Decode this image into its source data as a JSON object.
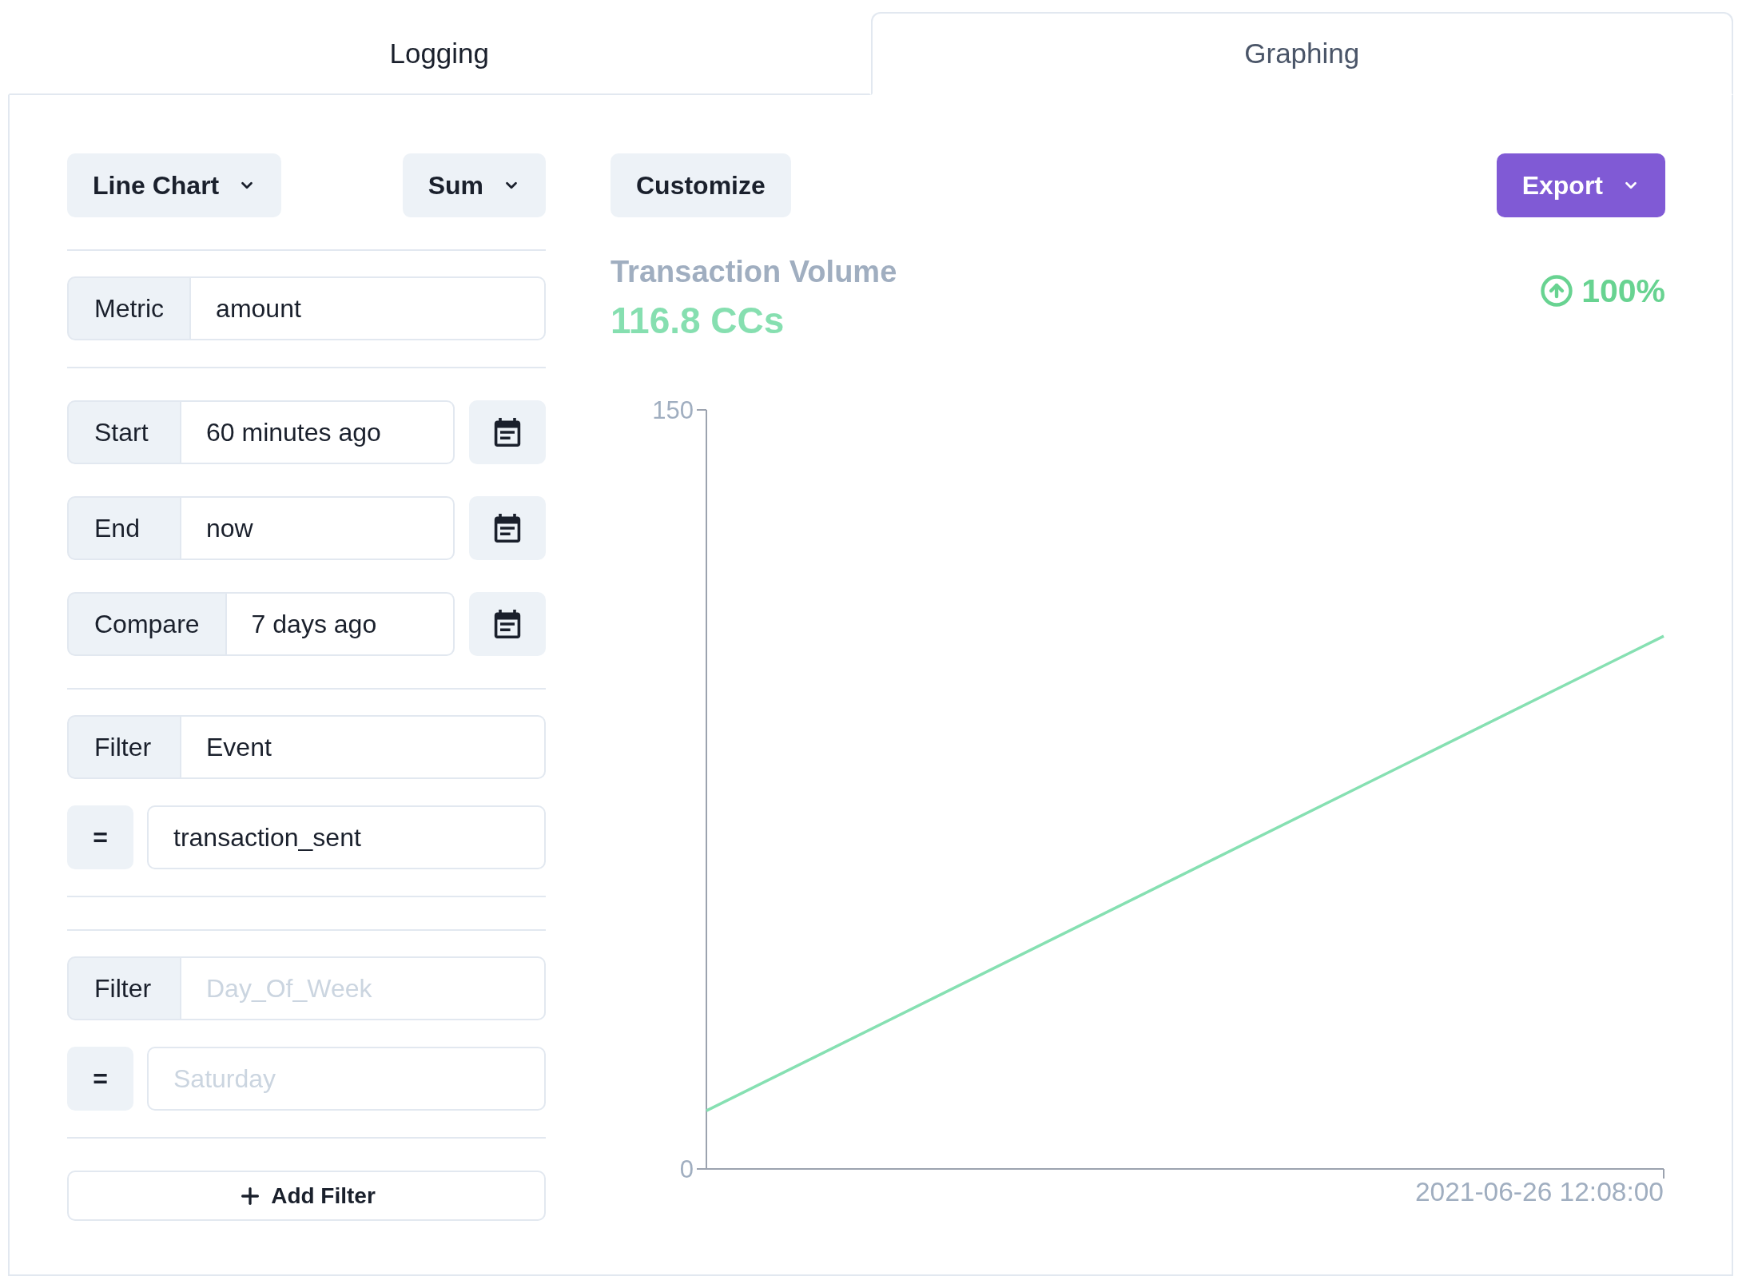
{
  "tabs": [
    {
      "label": "Logging",
      "selected": false
    },
    {
      "label": "Graphing",
      "selected": true
    }
  ],
  "query": {
    "chart_type": "Line Chart",
    "aggregation": "Sum",
    "metric": {
      "label": "Metric",
      "value": "amount"
    },
    "time_range": [
      {
        "label": "Start",
        "value": "60 minutes ago"
      },
      {
        "label": "End",
        "value": "now"
      },
      {
        "label": "Compare",
        "value": "7 days ago"
      }
    ],
    "filters": [
      {
        "label": "Filter",
        "field": {
          "value": "Event"
        },
        "operator": "=",
        "operand": {
          "value": "transaction_sent"
        }
      },
      {
        "label": "Filter",
        "field": {
          "placeholder": "Day_Of_Week"
        },
        "operator": "=",
        "operand": {
          "placeholder": "Saturday"
        }
      }
    ],
    "add_filter": "Add Filter"
  },
  "graph": {
    "customize": "Customize",
    "export": "Export",
    "title": "Transaction Volume",
    "total": "116.8 CCs",
    "change": "100%",
    "chart_data": {
      "type": "line",
      "categories": [
        null,
        null
      ],
      "ylim": [
        0,
        150
      ],
      "yticks": [
        {
          "value": 0,
          "label": "0"
        },
        {
          "value": 150,
          "label": "150"
        }
      ],
      "series": [
        {
          "color": "#86e0b2",
          "values": [
            11.5,
            105.3
          ]
        }
      ],
      "annotations": [
        {
          "text": "2021-06-26 12:08:00"
        }
      ]
    }
  }
}
